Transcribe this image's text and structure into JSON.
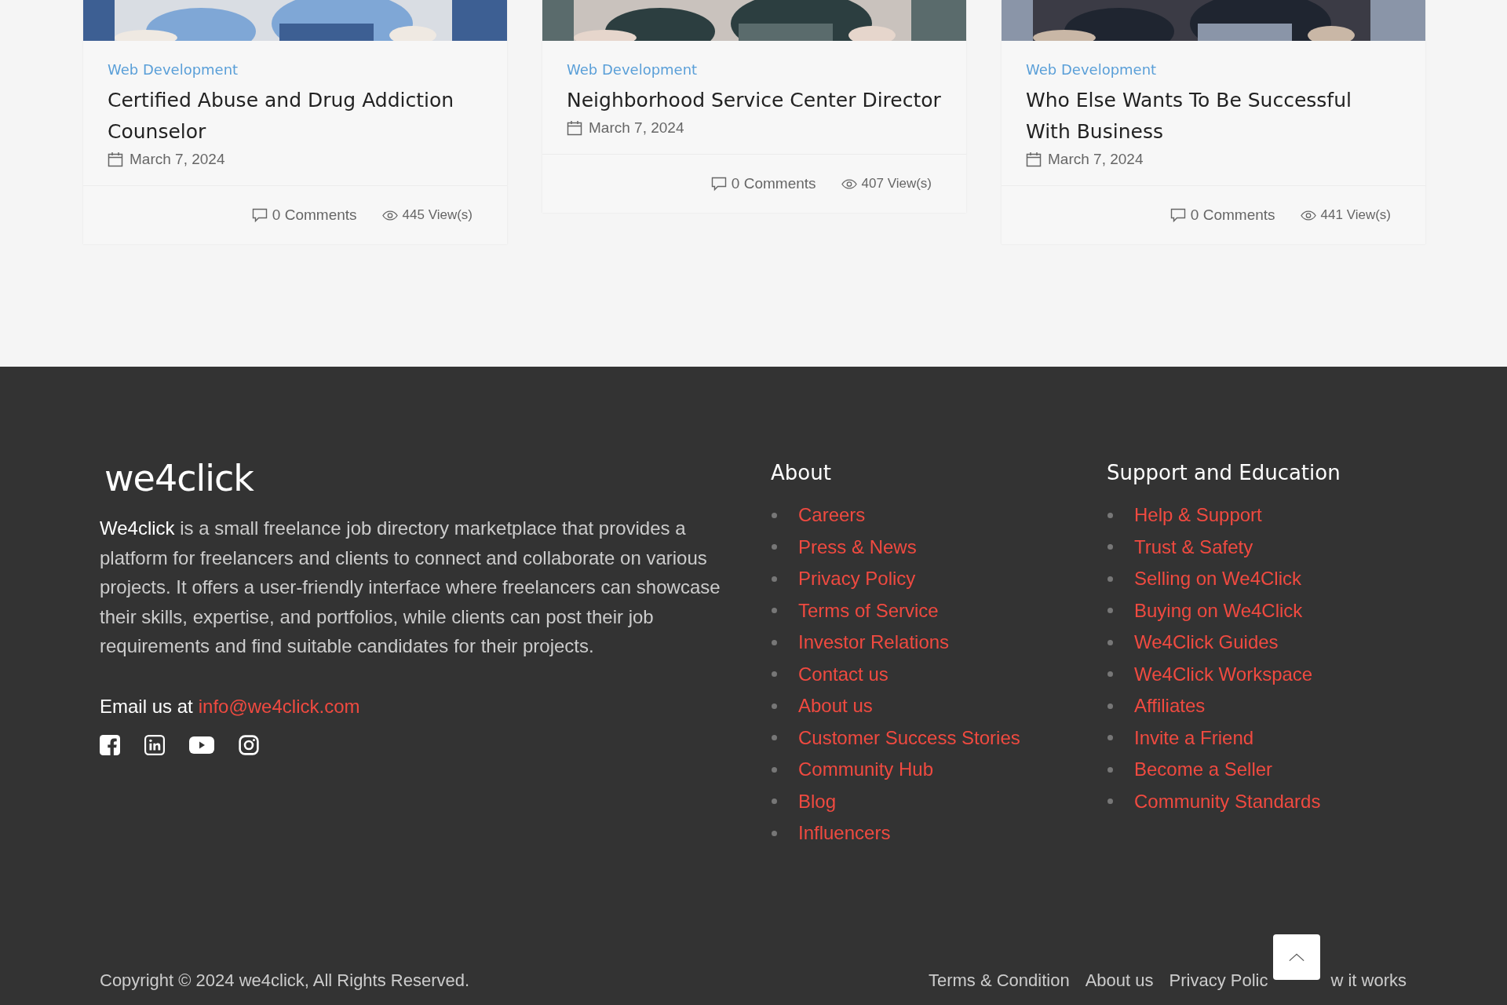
{
  "posts": [
    {
      "category": "Web Development",
      "title": "Certified Abuse and Drug Addiction Counselor",
      "date": "March 7, 2024",
      "comments": "0 Comments",
      "views": "445 View(s)"
    },
    {
      "category": "Web Development",
      "title": "Neighborhood Service Center Director",
      "date": "March 7, 2024",
      "comments": "0 Comments",
      "views": "407 View(s)"
    },
    {
      "category": "Web Development",
      "title": "Who Else Wants To Be Successful With Business",
      "date": "March 7, 2024",
      "comments": "0 Comments",
      "views": "441 View(s)"
    }
  ],
  "footer": {
    "logo": "we4click",
    "description": "**We4click** is a small freelance job directory marketplace that provides a platform for freelancers and clients to connect and collaborate on various projects. It offers a user-friendly interface where freelancers can showcase their skills, expertise, and portfolios, while clients can post their job requirements and find suitable candidates for their projects.",
    "email_label": "Email us at",
    "email": "info@we4click.com",
    "social": [
      {
        "kind": "facebook"
      },
      {
        "kind": "linkedin"
      },
      {
        "kind": "youtube"
      },
      {
        "kind": "instagram"
      }
    ],
    "columns": [
      {
        "heading": "About",
        "links": [
          "Careers",
          "Press & News",
          "Privacy Policy",
          "Terms of Service",
          "Investor Relations",
          "Contact us",
          "About us",
          "Customer Success Stories",
          "Community Hub",
          "Blog",
          "Influencers"
        ]
      },
      {
        "heading": "Support and Education",
        "links": [
          "Help & Support",
          "Trust & Safety",
          "Selling on We4Click",
          "Buying on We4Click",
          "We4Click Guides",
          "We4Click Workspace",
          "Affiliates",
          "Invite a Friend",
          "Become a Seller",
          "Community Standards"
        ]
      }
    ],
    "copyright": "Copyright © 2024 we4click, All Rights Reserved.",
    "bottom_links": [
      "Terms & Condition",
      "About us",
      "Privacy Polic",
      "w it works"
    ]
  }
}
